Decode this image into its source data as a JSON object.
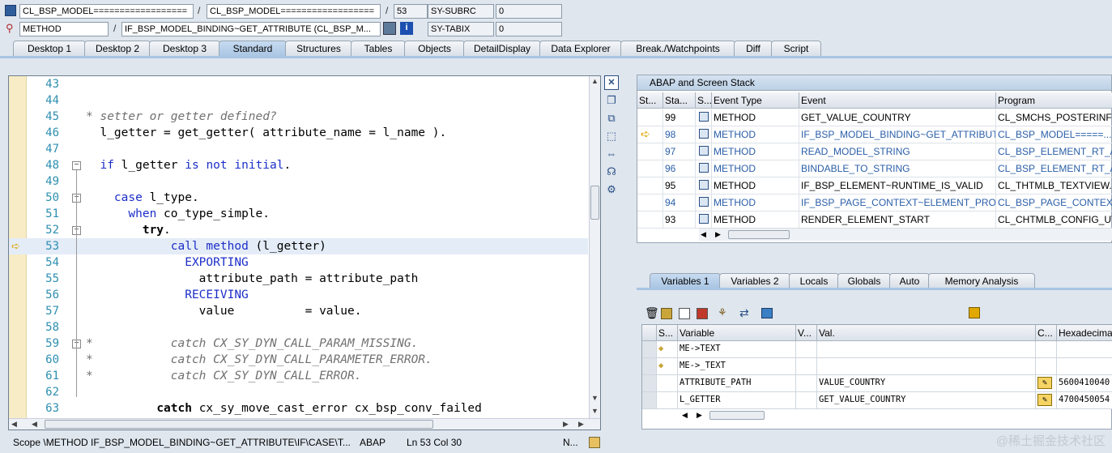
{
  "top": {
    "row1": {
      "f1": "CL_BSP_MODEL==================",
      "sep1": "/",
      "f2": "CL_BSP_MODEL==================",
      "sep2": "/",
      "line": "53",
      "sy1": "SY-SUBRC",
      "v1": "0"
    },
    "row2": {
      "f1": "METHOD",
      "sep1": "/",
      "f2": "IF_BSP_MODEL_BINDING~GET_ATTRIBUTE (CL_BSP_M...",
      "sy2": "SY-TABIX",
      "v2": "0"
    }
  },
  "tabs": [
    "Desktop 1",
    "Desktop 2",
    "Desktop 3",
    "Standard",
    "Structures",
    "Tables",
    "Objects",
    "DetailDisplay",
    "Data Explorer",
    "Break./Watchpoints",
    "Diff",
    "Script"
  ],
  "active_tab": "Standard",
  "editor": {
    "lines": [
      {
        "n": "43",
        "t": ""
      },
      {
        "n": "44",
        "t": ""
      },
      {
        "n": "45",
        "t": "* setter or getter defined?"
      },
      {
        "n": "46",
        "t": "  l_getter = get_getter( attribute_name = l_name )."
      },
      {
        "n": "47",
        "t": ""
      },
      {
        "n": "48",
        "t": "  if l_getter is not initial."
      },
      {
        "n": "49",
        "t": ""
      },
      {
        "n": "50",
        "t": "    case l_type."
      },
      {
        "n": "51",
        "t": "      when co_type_simple."
      },
      {
        "n": "52",
        "t": "        try."
      },
      {
        "n": "53",
        "t": "            call method (l_getter)"
      },
      {
        "n": "54",
        "t": "              EXPORTING"
      },
      {
        "n": "55",
        "t": "                attribute_path = attribute_path"
      },
      {
        "n": "56",
        "t": "              RECEIVING"
      },
      {
        "n": "57",
        "t": "                value          = value."
      },
      {
        "n": "58",
        "t": ""
      },
      {
        "n": "59",
        "t": "*           catch CX_SY_DYN_CALL_PARAM_MISSING."
      },
      {
        "n": "60",
        "t": "*           catch CX_SY_DYN_CALL_PARAMETER_ERROR."
      },
      {
        "n": "61",
        "t": "*           catch CX_SY_DYN_CALL_ERROR."
      },
      {
        "n": "62",
        "t": ""
      },
      {
        "n": "63",
        "t": "          catch cx_sy_move_cast_error cx_bsp_conv_failed"
      }
    ]
  },
  "status": {
    "scope": "Scope \\METHOD IF_BSP_MODEL_BINDING~GET_ATTRIBUTE\\IF\\CASE\\T...",
    "lang": "ABAP",
    "pos": "Ln  53 Col  30",
    "mode": "N..."
  },
  "stack": {
    "title": "ABAP and Screen Stack",
    "headers": [
      "St...",
      "Sta...",
      "S...",
      "Event Type",
      "Event",
      "Program"
    ],
    "rows": [
      {
        "level": "99",
        "type": "METHOD",
        "event": "GET_VALUE_COUNTRY",
        "program": "CL_SMCHS_POSTERINFO...",
        "blue": false,
        "cur": false
      },
      {
        "level": "98",
        "type": "METHOD",
        "event": "IF_BSP_MODEL_BINDING~GET_ATTRIBUTE",
        "program": "CL_BSP_MODEL=====...",
        "blue": true,
        "cur": true
      },
      {
        "level": "97",
        "type": "METHOD",
        "event": "READ_MODEL_STRING",
        "program": "CL_BSP_ELEMENT_RT_A...",
        "blue": true,
        "cur": false
      },
      {
        "level": "96",
        "type": "METHOD",
        "event": "BINDABLE_TO_STRING",
        "program": "CL_BSP_ELEMENT_RT_A...",
        "blue": true,
        "cur": false
      },
      {
        "level": "95",
        "type": "METHOD",
        "event": "IF_BSP_ELEMENT~RUNTIME_IS_VALID",
        "program": "CL_THTMLB_TEXTVIEW...",
        "blue": false,
        "cur": false
      },
      {
        "level": "94",
        "type": "METHOD",
        "event": "IF_BSP_PAGE_CONTEXT~ELEMENT_PROC...",
        "program": "CL_BSP_PAGE_CONTEX...",
        "blue": true,
        "cur": false
      },
      {
        "level": "93",
        "type": "METHOD",
        "event": "RENDER_ELEMENT_START",
        "program": "CL_CHTMLB_CONFIG_UT...",
        "blue": false,
        "cur": false
      }
    ]
  },
  "var_tabs": [
    "Variables 1",
    "Variables 2",
    "Locals",
    "Globals",
    "Auto",
    "Memory Analysis"
  ],
  "vars": {
    "headers": [
      "S...",
      "Variable",
      "V...",
      "Val.",
      "C...",
      "Hexadecimal"
    ],
    "rows": [
      {
        "name": "ME->TEXT",
        "val": "",
        "hex": ""
      },
      {
        "name": "ME->_TEXT",
        "val": "",
        "hex": ""
      },
      {
        "name": "ATTRIBUTE_PATH",
        "val": "VALUE_COUNTRY",
        "hex": "5600410040"
      },
      {
        "name": "L_GETTER",
        "val": "GET_VALUE_COUNTRY",
        "hex": "4700450054"
      }
    ]
  },
  "watermark": "@稀土掘金技术社区"
}
